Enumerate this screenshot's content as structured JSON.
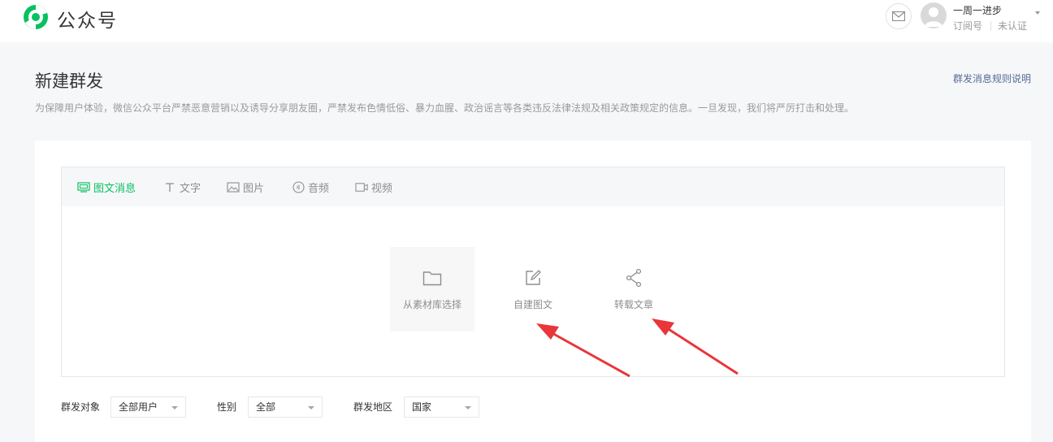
{
  "header": {
    "brand": "公众号",
    "account": {
      "name": "一周一进步",
      "type": "订阅号",
      "verification": "未认证"
    }
  },
  "page": {
    "title": "新建群发",
    "rules_link": "群发消息规则说明",
    "notice": "为保障用户体验，微信公众平台严禁恶意营销以及诱导分享朋友圈，严禁发布色情低俗、暴力血腥、政治谣言等各类违反法律法规及相关政策规定的信息。一旦发现，我们将严厉打击和处理。"
  },
  "tabs": [
    {
      "label": "图文消息",
      "icon": "article-icon",
      "active": true
    },
    {
      "label": "文字",
      "icon": "text-icon",
      "active": false
    },
    {
      "label": "图片",
      "icon": "image-icon",
      "active": false
    },
    {
      "label": "音频",
      "icon": "audio-icon",
      "active": false
    },
    {
      "label": "视频",
      "icon": "video-icon",
      "active": false
    }
  ],
  "actions": [
    {
      "label": "从素材库选择",
      "icon": "folder-icon"
    },
    {
      "label": "自建图文",
      "icon": "edit-icon"
    },
    {
      "label": "转载文章",
      "icon": "share-icon"
    }
  ],
  "filters": {
    "target": {
      "label": "群发对象",
      "value": "全部用户"
    },
    "gender": {
      "label": "性别",
      "value": "全部"
    },
    "region": {
      "label": "群发地区",
      "value": "国家"
    }
  },
  "colors": {
    "accent": "#07c160",
    "link": "#576b95",
    "annotation_arrow": "#e8363a"
  }
}
